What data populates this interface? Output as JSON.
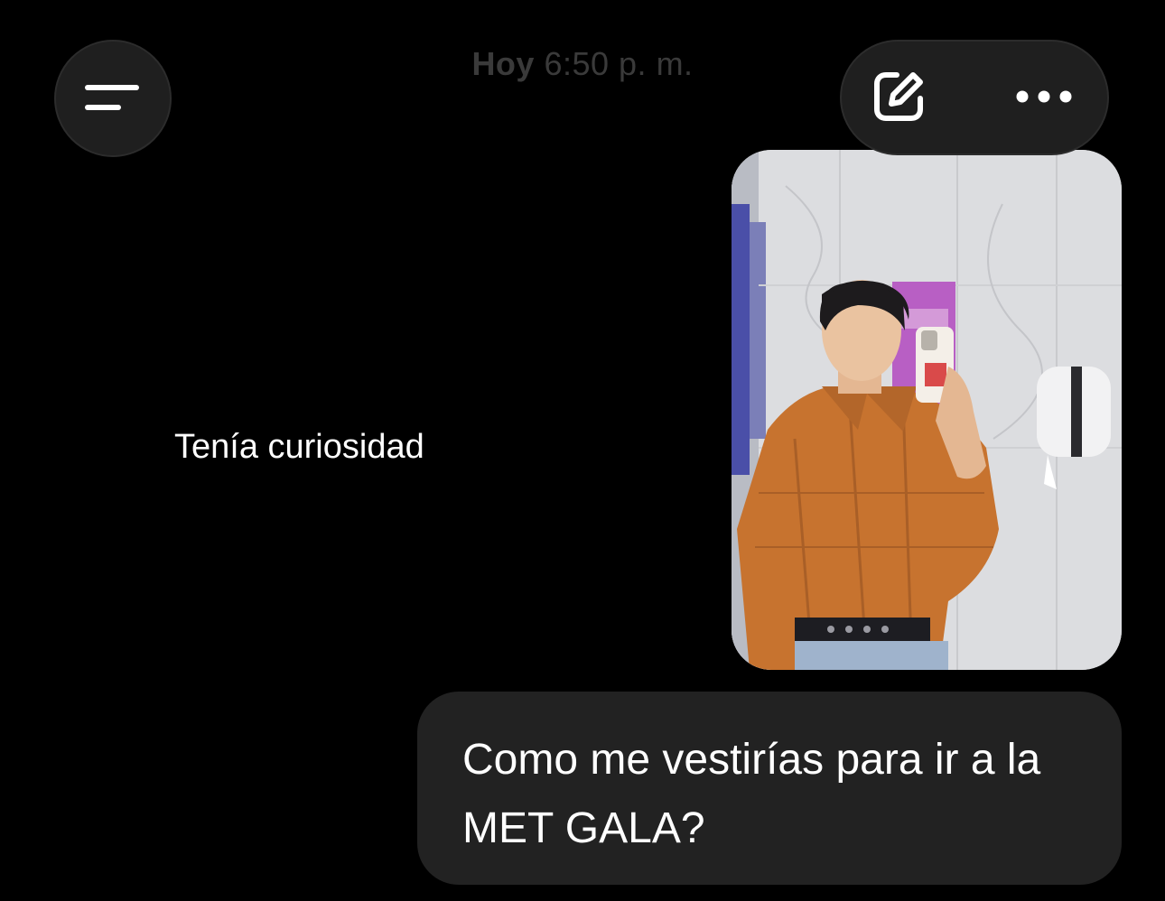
{
  "header": {
    "timestamp_day": "Hoy",
    "timestamp_time": "6:50 p. m.",
    "menu_icon": "hamburger-menu-icon",
    "edit_icon": "edit-compose-icon",
    "more_icon": "more-dots-icon"
  },
  "messages": {
    "received": {
      "text": "Tenía curiosidad"
    },
    "sent_photo": {
      "icon": "photo-attachment"
    },
    "sent": {
      "line1": "Como me vestirías para ir a la",
      "line2": "MET GALA?"
    }
  },
  "colors": {
    "background": "#000000",
    "button_bg": "#1f1f1f",
    "bubble_bg": "#222222",
    "timestamp": "#3a3a3a",
    "text": "#ffffff"
  }
}
